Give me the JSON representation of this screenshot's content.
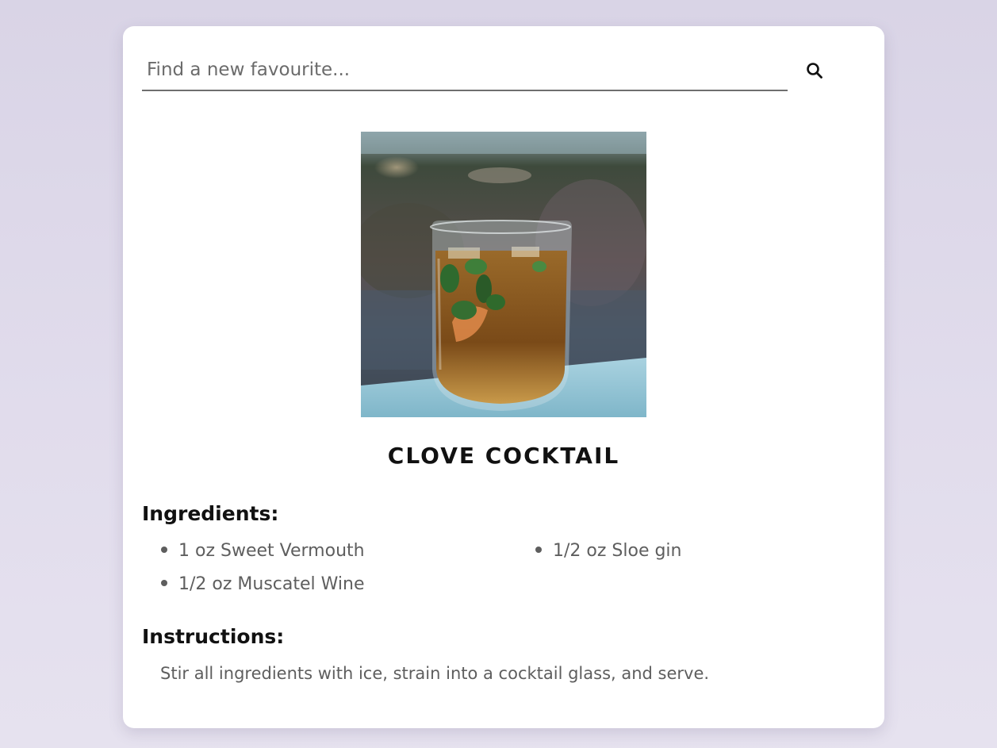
{
  "search": {
    "placeholder": "Find a new favourite...",
    "value": "",
    "button_icon": "search-icon"
  },
  "drink": {
    "image_alt": "Clove Cocktail",
    "name": "CLOVE COCKTAIL",
    "ingredients_heading": "Ingredients:",
    "ingredients": [
      "1 oz Sweet Vermouth",
      "1/2 oz Sloe gin",
      "1/2 oz Muscatel Wine"
    ],
    "instructions_heading": "Instructions:",
    "instructions": "Stir all ingredients with ice, strain into a cocktail glass, and serve."
  },
  "colors": {
    "background": "#dcd7e8",
    "card": "#ffffff",
    "text_primary": "#111111",
    "text_secondary": "#5e5e5e"
  }
}
